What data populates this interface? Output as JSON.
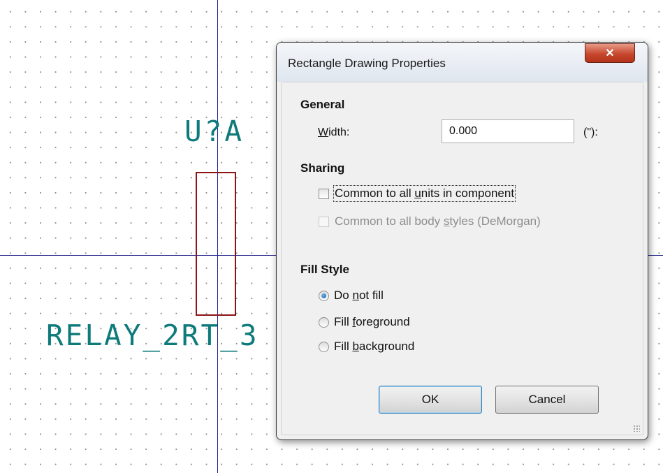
{
  "schematic": {
    "reference": "U?A",
    "value": "RELAY_2RT_3",
    "colors": {
      "axis": "#1d1d8a",
      "body": "#8b1414",
      "text": "#0e7a7a",
      "grid_dot": "#8c8c8c"
    }
  },
  "dialog": {
    "title": "Rectangle Drawing Properties",
    "close_icon": "close-x",
    "general": {
      "heading": "General",
      "width_label": "Width:",
      "width_value": "0.000",
      "unit": "(\"):"
    },
    "sharing": {
      "heading": "Sharing",
      "common_units": {
        "label": "Common to all units in component",
        "checked": false,
        "enabled": true
      },
      "common_body_styles": {
        "label": "Common to all body styles (DeMorgan)",
        "checked": false,
        "enabled": false
      }
    },
    "fill_style": {
      "heading": "Fill Style",
      "options": [
        {
          "label": "Do not fill",
          "selected": true
        },
        {
          "label": "Fill foreground",
          "selected": false
        },
        {
          "label": "Fill background",
          "selected": false
        }
      ]
    },
    "buttons": {
      "ok": "OK",
      "cancel": "Cancel"
    }
  }
}
